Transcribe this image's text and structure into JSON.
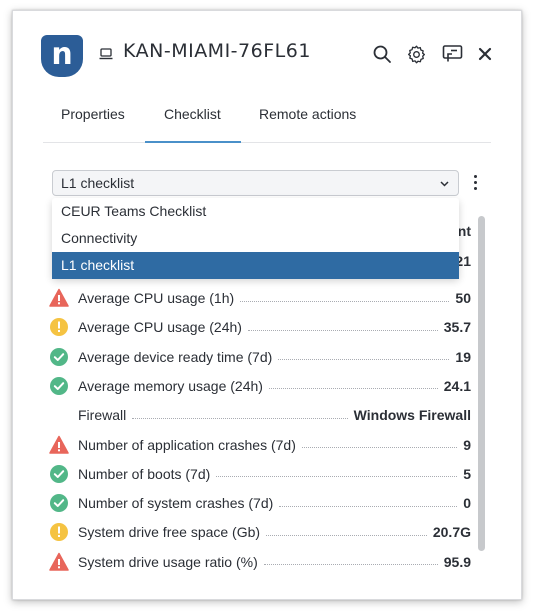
{
  "header": {
    "device_name": "KAN-MIAMI-76FL61",
    "logo_letter": "n",
    "icons": [
      "search-icon",
      "gear-icon",
      "remote-screen-icon",
      "close-icon"
    ]
  },
  "tabs": [
    {
      "label": "Properties",
      "active": false
    },
    {
      "label": "Checklist",
      "active": true
    },
    {
      "label": "Remote actions",
      "active": false
    }
  ],
  "checklist_select": {
    "value": "L1 checklist",
    "options": [
      "CEUR Teams Checklist",
      "Connectivity",
      "L1 checklist"
    ],
    "selected_option": "L1 checklist"
  },
  "hidden_row_fragments": {
    "header_tail": "nt",
    "value_tail": "21"
  },
  "checklist": [
    {
      "status": "error",
      "label": "Average CPU usage (1h)",
      "value": "50"
    },
    {
      "status": "warning",
      "label": "Average CPU usage (24h)",
      "value": "35.7"
    },
    {
      "status": "ok",
      "label": "Average device ready time (7d)",
      "value": "19"
    },
    {
      "status": "ok",
      "label": "Average memory usage (24h)",
      "value": "24.1"
    },
    {
      "status": "none",
      "label": "Firewall",
      "value": "Windows Firewall"
    },
    {
      "status": "error",
      "label": "Number of application crashes (7d)",
      "value": "9"
    },
    {
      "status": "ok",
      "label": "Number of boots (7d)",
      "value": "5"
    },
    {
      "status": "ok",
      "label": "Number of system crashes (7d)",
      "value": "0"
    },
    {
      "status": "warning",
      "label": "System drive free space (Gb)",
      "value": "20.7G"
    },
    {
      "status": "error",
      "label": "System drive usage ratio (%)",
      "value": "95.9"
    }
  ],
  "colors": {
    "brand": "#2c5d97",
    "tab_indicator": "#4a90c9",
    "selected_option": "#2f6ba3",
    "ok": "#52b788",
    "warning": "#f5c342",
    "error": "#e8665b"
  }
}
